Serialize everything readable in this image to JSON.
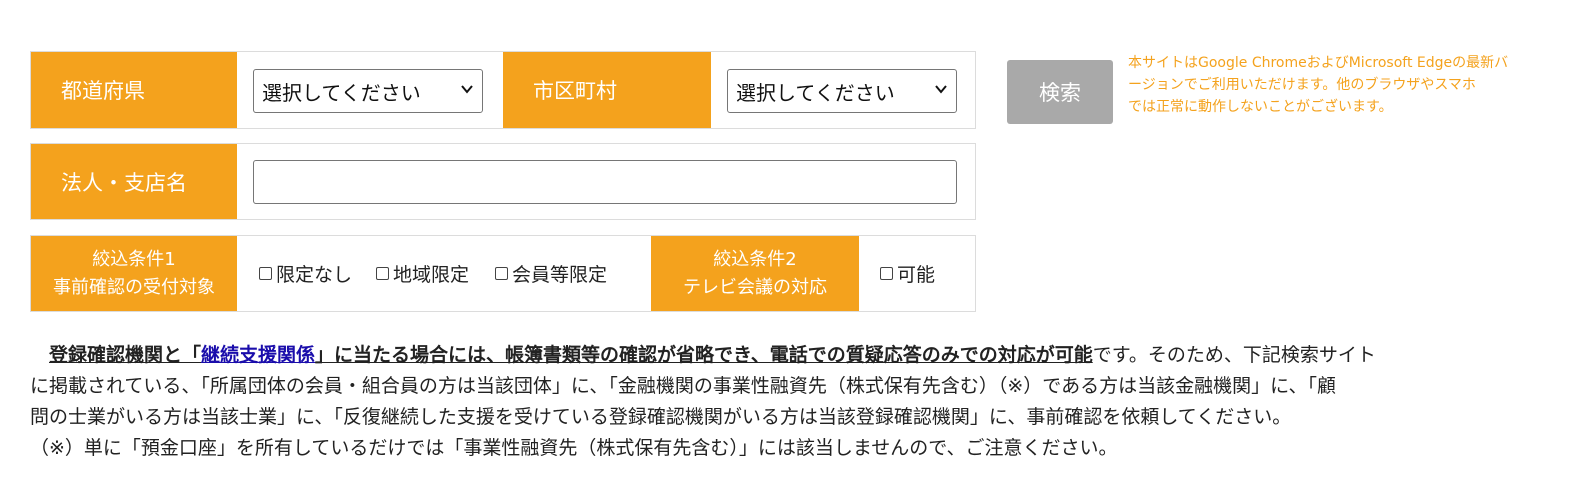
{
  "search_form": {
    "prefecture": {
      "label": "都道府県",
      "selected": "選択してください"
    },
    "municipality": {
      "label": "市区町村",
      "selected": "選択してください"
    },
    "corporation": {
      "label": "法人・支店名",
      "value": ""
    },
    "filter1": {
      "label_line1": "絞込条件1",
      "label_line2": "事前確認の受付対象",
      "options": [
        "限定なし",
        "地域限定",
        "会員等限定"
      ]
    },
    "filter2": {
      "label_line1": "絞込条件2",
      "label_line2": "テレビ会議の対応",
      "options": [
        "可能"
      ]
    },
    "search_button": "検索"
  },
  "browser_notice": {
    "line1": "本サイトはGoogle ChromeおよびMicrosoft Edgeの最新バ",
    "line2": "ージョンでご利用いただけます。他のブラウザやスマホ",
    "line3": "では正常に動作しないことがございます。"
  },
  "description": {
    "bold_pre": "登録確認機関と「",
    "link": "継続支援関係",
    "bold_post": "」に当たる場合には、帳簿書類等の確認が省略でき、電話での質疑応答のみでの対応が可能",
    "rest_line1": "です。そのため、下記検索サイト",
    "line2": "に掲載されている、「所属団体の会員・組合員の方は当該団体」に、「金融機関の事業性融資先（株式保有先含む）（※）である方は当該金融機関」に、「顧",
    "line3": "問の士業がいる方は当該士業」に、「反復継続した支援を受けている登録確認機関がいる方は当該登録確認機関」に、事前確認を依頼してください。",
    "line4": "（※）単に「預金口座」を所有しているだけでは「事業性融資先（株式保有先含む）」には該当しませんので、ご注意ください。"
  },
  "colors": {
    "accent": "#f4a21d",
    "button": "#a9a9a9",
    "link": "#1a0dab"
  }
}
